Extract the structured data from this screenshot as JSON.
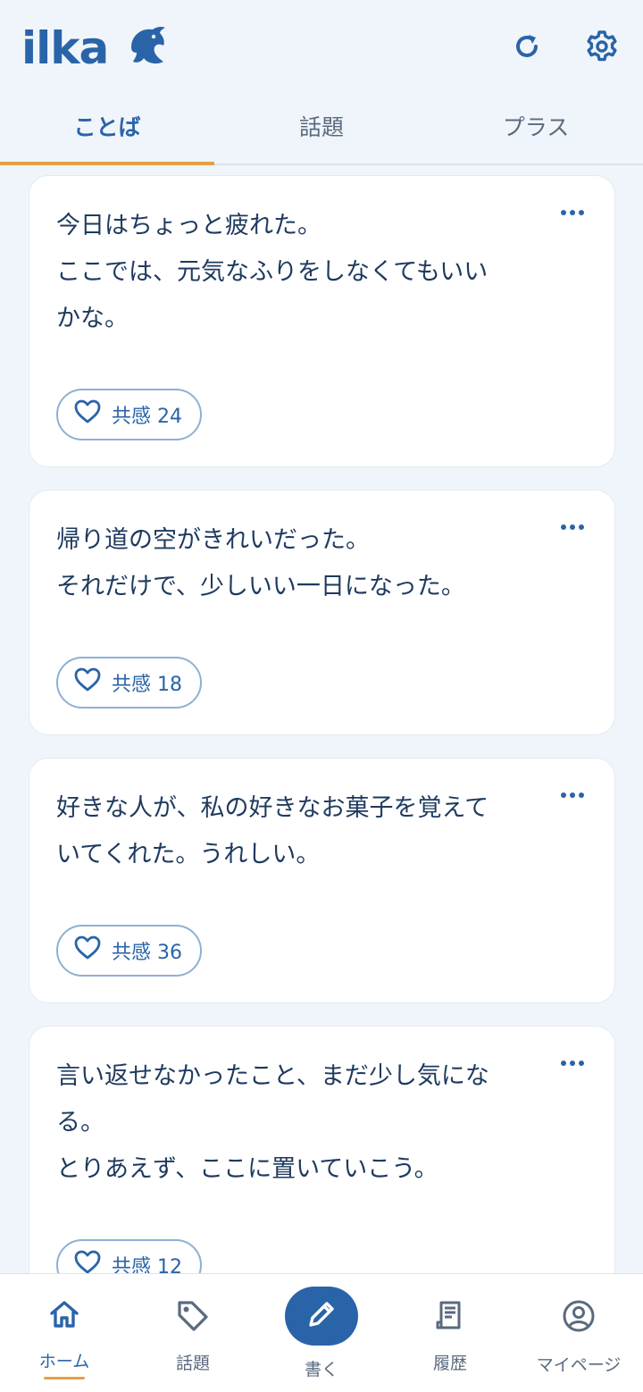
{
  "app": {
    "logo_text": "ilka",
    "accent": "#2a64a8",
    "highlight": "#e5a044"
  },
  "header": {
    "refresh_icon": "refresh-icon",
    "settings_icon": "gear-icon"
  },
  "tabs": [
    {
      "label": "ことば",
      "active": true
    },
    {
      "label": "話題",
      "active": false
    },
    {
      "label": "プラス",
      "active": false
    }
  ],
  "posts": [
    {
      "text": "今日はちょっと疲れた。\nここでは、元気なふりをしなくてもいい\nかな。",
      "like_label": "共感 24"
    },
    {
      "text": "帰り道の空がきれいだった。\nそれだけで、少しいい一日になった。",
      "like_label": "共感 18"
    },
    {
      "text": "好きな人が、私の好きなお菓子を覚えて\nいてくれた。うれしい。",
      "like_label": "共感 36"
    },
    {
      "text": "言い返せなかったこと、まだ少し気にな\nる。\nとりあえず、ここに置いていこう。",
      "like_label": "共感 12"
    }
  ],
  "bottom_nav": [
    {
      "label": "ホーム",
      "icon": "home-icon",
      "active": true
    },
    {
      "label": "話題",
      "icon": "tag-icon",
      "active": false
    },
    {
      "label": "書く",
      "icon": "pencil-icon",
      "active": false
    },
    {
      "label": "履歴",
      "icon": "receipt-icon",
      "active": false
    },
    {
      "label": "マイページ",
      "icon": "user-circle-icon",
      "active": false
    }
  ]
}
